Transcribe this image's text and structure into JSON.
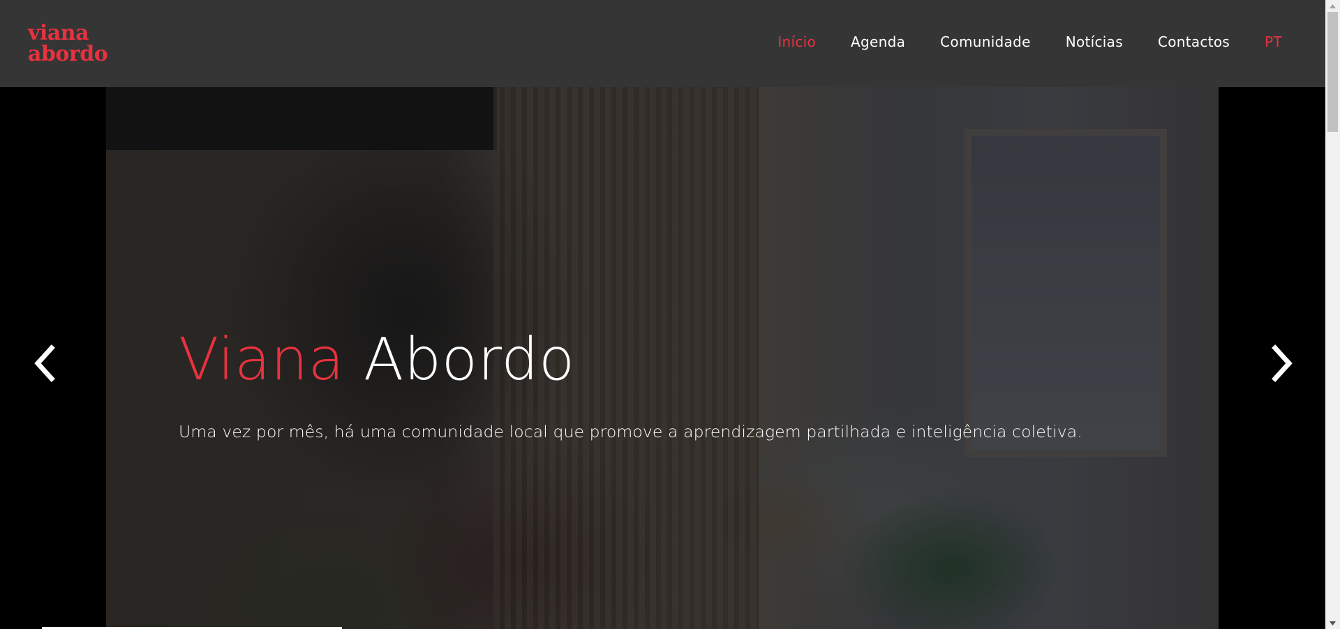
{
  "logo": {
    "line1": "viana",
    "line2": "abordo"
  },
  "nav": {
    "items": [
      {
        "label": "Início",
        "active": true
      },
      {
        "label": "Agenda",
        "active": false
      },
      {
        "label": "Comunidade",
        "active": false
      },
      {
        "label": "Notícias",
        "active": false
      },
      {
        "label": "Contactos",
        "active": false
      }
    ],
    "language": "PT"
  },
  "hero": {
    "title_accent": "Viana",
    "title_rest": "Abordo",
    "subtitle": "Uma vez por mês, há uma comunidade local que promove a aprendizagem partilhada e inteligência coletiva.",
    "prev_icon": "chevron-left-icon",
    "next_icon": "chevron-right-icon"
  },
  "colors": {
    "accent": "#e8323f",
    "header_bg": "#353535",
    "text": "#ffffff"
  }
}
